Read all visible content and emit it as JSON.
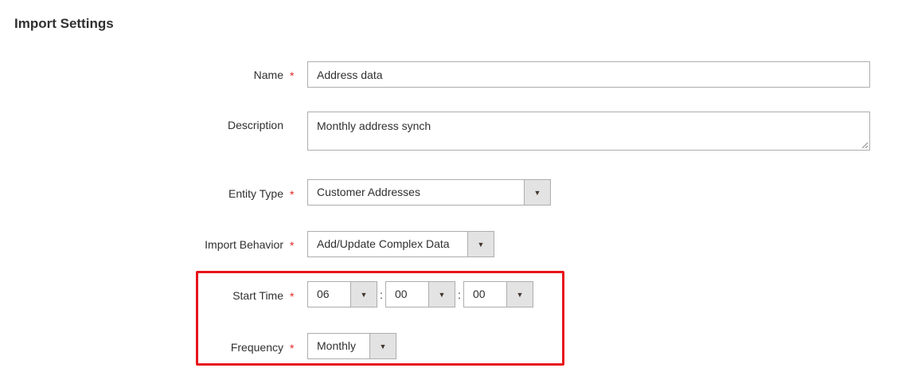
{
  "section": {
    "title": "Import Settings"
  },
  "fields": {
    "name": {
      "label": "Name",
      "required": "*",
      "value": "Address data"
    },
    "description": {
      "label": "Description",
      "value": "Monthly address synch"
    },
    "entity_type": {
      "label": "Entity Type",
      "required": "*",
      "selected": "Customer Addresses"
    },
    "import_behavior": {
      "label": "Import Behavior",
      "required": "*",
      "selected": "Add/Update Complex Data"
    },
    "start_time": {
      "label": "Start Time",
      "required": "*",
      "hour": "06",
      "minute": "00",
      "second": "00",
      "separator": ":"
    },
    "frequency": {
      "label": "Frequency",
      "required": "*",
      "selected": "Monthly"
    }
  },
  "icons": {
    "dropdown": "caret-down-icon",
    "dropdown_glyph": "▼"
  },
  "colors": {
    "required_star": "#e22626",
    "highlight_border": "#e8141b",
    "field_border": "#adadad",
    "arrow_bg": "#e3e3e3"
  }
}
